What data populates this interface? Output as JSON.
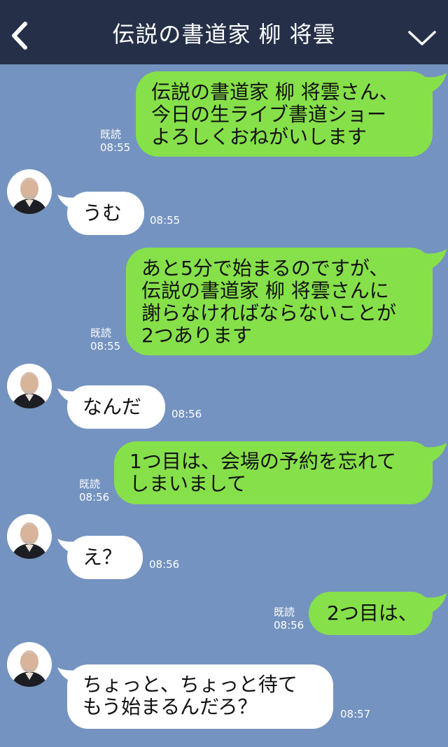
{
  "header": {
    "title": "伝説の書道家 柳 将雲",
    "back_icon": "chevron-left-icon",
    "menu_icon": "chevron-down-icon"
  },
  "colors": {
    "background": "#7493c0",
    "header": "#253048",
    "outgoing_bubble": "#86e04a",
    "incoming_bubble": "#ffffff"
  },
  "messages": [
    {
      "side": "out",
      "lines": [
        "伝説の書道家 柳 将雲さん、",
        "今日の生ライブ書道ショー",
        "よろしくおねがいします"
      ],
      "read": "既読",
      "time": "08:55"
    },
    {
      "side": "in",
      "lines": [
        "うむ"
      ],
      "time": "08:55"
    },
    {
      "side": "out",
      "lines": [
        "あと5分で始まるのですが、",
        "伝説の書道家 柳 将雲さんに",
        "謝らなければならないことが",
        "2つあります"
      ],
      "read": "既読",
      "time": "08:55"
    },
    {
      "side": "in",
      "lines": [
        "なんだ"
      ],
      "time": "08:56"
    },
    {
      "side": "out",
      "lines": [
        "1つ目は、会場の予約を忘れて",
        "しまいまして"
      ],
      "read": "既読",
      "time": "08:56"
    },
    {
      "side": "in",
      "lines": [
        "え？"
      ],
      "time": "08:56"
    },
    {
      "side": "out",
      "lines": [
        "2つ目は、"
      ],
      "read": "既読",
      "time": "08:56"
    },
    {
      "side": "in",
      "lines": [
        "ちょっと、ちょっと待て",
        "もう始まるんだろ？"
      ],
      "time": "08:57"
    }
  ]
}
